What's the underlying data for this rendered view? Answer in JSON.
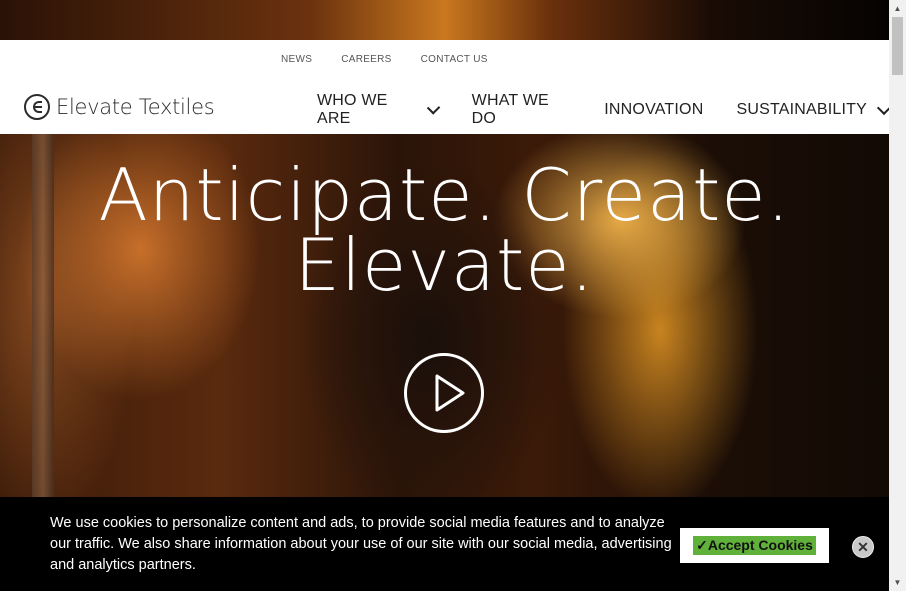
{
  "header": {
    "utility_nav": [
      "NEWS",
      "CAREERS",
      "CONTACT US"
    ],
    "logo_text": "Elevate Textiles",
    "main_nav": [
      {
        "label": "WHO WE ARE",
        "has_dropdown": true
      },
      {
        "label": "WHAT WE DO",
        "has_dropdown": false
      },
      {
        "label": "INNOVATION",
        "has_dropdown": false
      },
      {
        "label": "SUSTAINABILITY",
        "has_dropdown": true
      }
    ]
  },
  "hero": {
    "headline_line1": "Anticipate. Create.",
    "headline_line2": "Elevate.",
    "play_icon": "play-icon"
  },
  "cookie_banner": {
    "message": "We use cookies to personalize content and ads, to provide social media features and to analyze our traffic. We also share information about your use of our site with our social media, advertising and analytics partners.",
    "accept_label": "✓Accept Cookies",
    "close_icon": "close-icon"
  },
  "colors": {
    "accept_highlight": "#5fb13a",
    "banner_bg": "#000000",
    "header_bg": "#ffffff"
  }
}
